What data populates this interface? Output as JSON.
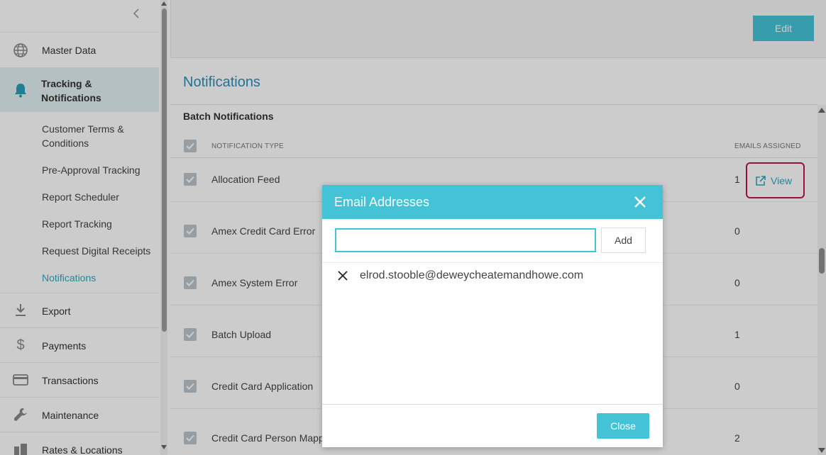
{
  "sidebar": {
    "items": [
      {
        "label": "Master Data",
        "icon": "globe-icon"
      },
      {
        "label": "Tracking & Notifications",
        "icon": "bell-icon",
        "active": true
      },
      {
        "label": "Export",
        "icon": "download-icon"
      },
      {
        "label": "Payments",
        "icon": "dollar-icon"
      },
      {
        "label": "Transactions",
        "icon": "credit-card-icon"
      },
      {
        "label": "Maintenance",
        "icon": "wrench-icon"
      },
      {
        "label": "Rates & Locations",
        "icon": "buildings-icon"
      }
    ],
    "tracking_line1": "Tracking &",
    "tracking_line2": "Notifications",
    "sub_items": [
      {
        "label": "Customer Terms & Conditions"
      },
      {
        "label": "Pre-Approval Tracking"
      },
      {
        "label": "Report Scheduler"
      },
      {
        "label": "Report Tracking"
      },
      {
        "label": "Request Digital Receipts"
      },
      {
        "label": "Notifications",
        "current": true
      }
    ]
  },
  "toolbar": {
    "edit_label": "Edit"
  },
  "page": {
    "title": "Notifications",
    "section": "Batch Notifications",
    "columns": {
      "type": "NOTIFICATION TYPE",
      "emails": "EMAILS ASSIGNED"
    },
    "rows": [
      {
        "label": "Allocation Feed",
        "count": "1",
        "checked": true
      },
      {
        "label": "Amex Credit Card Error",
        "count": "0",
        "checked": true
      },
      {
        "label": "Amex System Error",
        "count": "0",
        "checked": true
      },
      {
        "label": "Batch Upload",
        "count": "1",
        "checked": true
      },
      {
        "label": "Credit Card Application",
        "count": "0",
        "checked": true
      },
      {
        "label": "Credit Card Person Mapp",
        "count": "2",
        "checked": true
      }
    ],
    "view_label": "View"
  },
  "modal": {
    "title": "Email Addresses",
    "input_value": "",
    "input_placeholder": "",
    "add_label": "Add",
    "emails": [
      "elrod.stooble@deweycheatemandhowe.com"
    ],
    "close_label": "Close"
  },
  "colors": {
    "accent": "#45c3d6",
    "title_blue": "#2c8fb9",
    "link": "#2ba9c3",
    "highlight_border": "#c0144f"
  }
}
